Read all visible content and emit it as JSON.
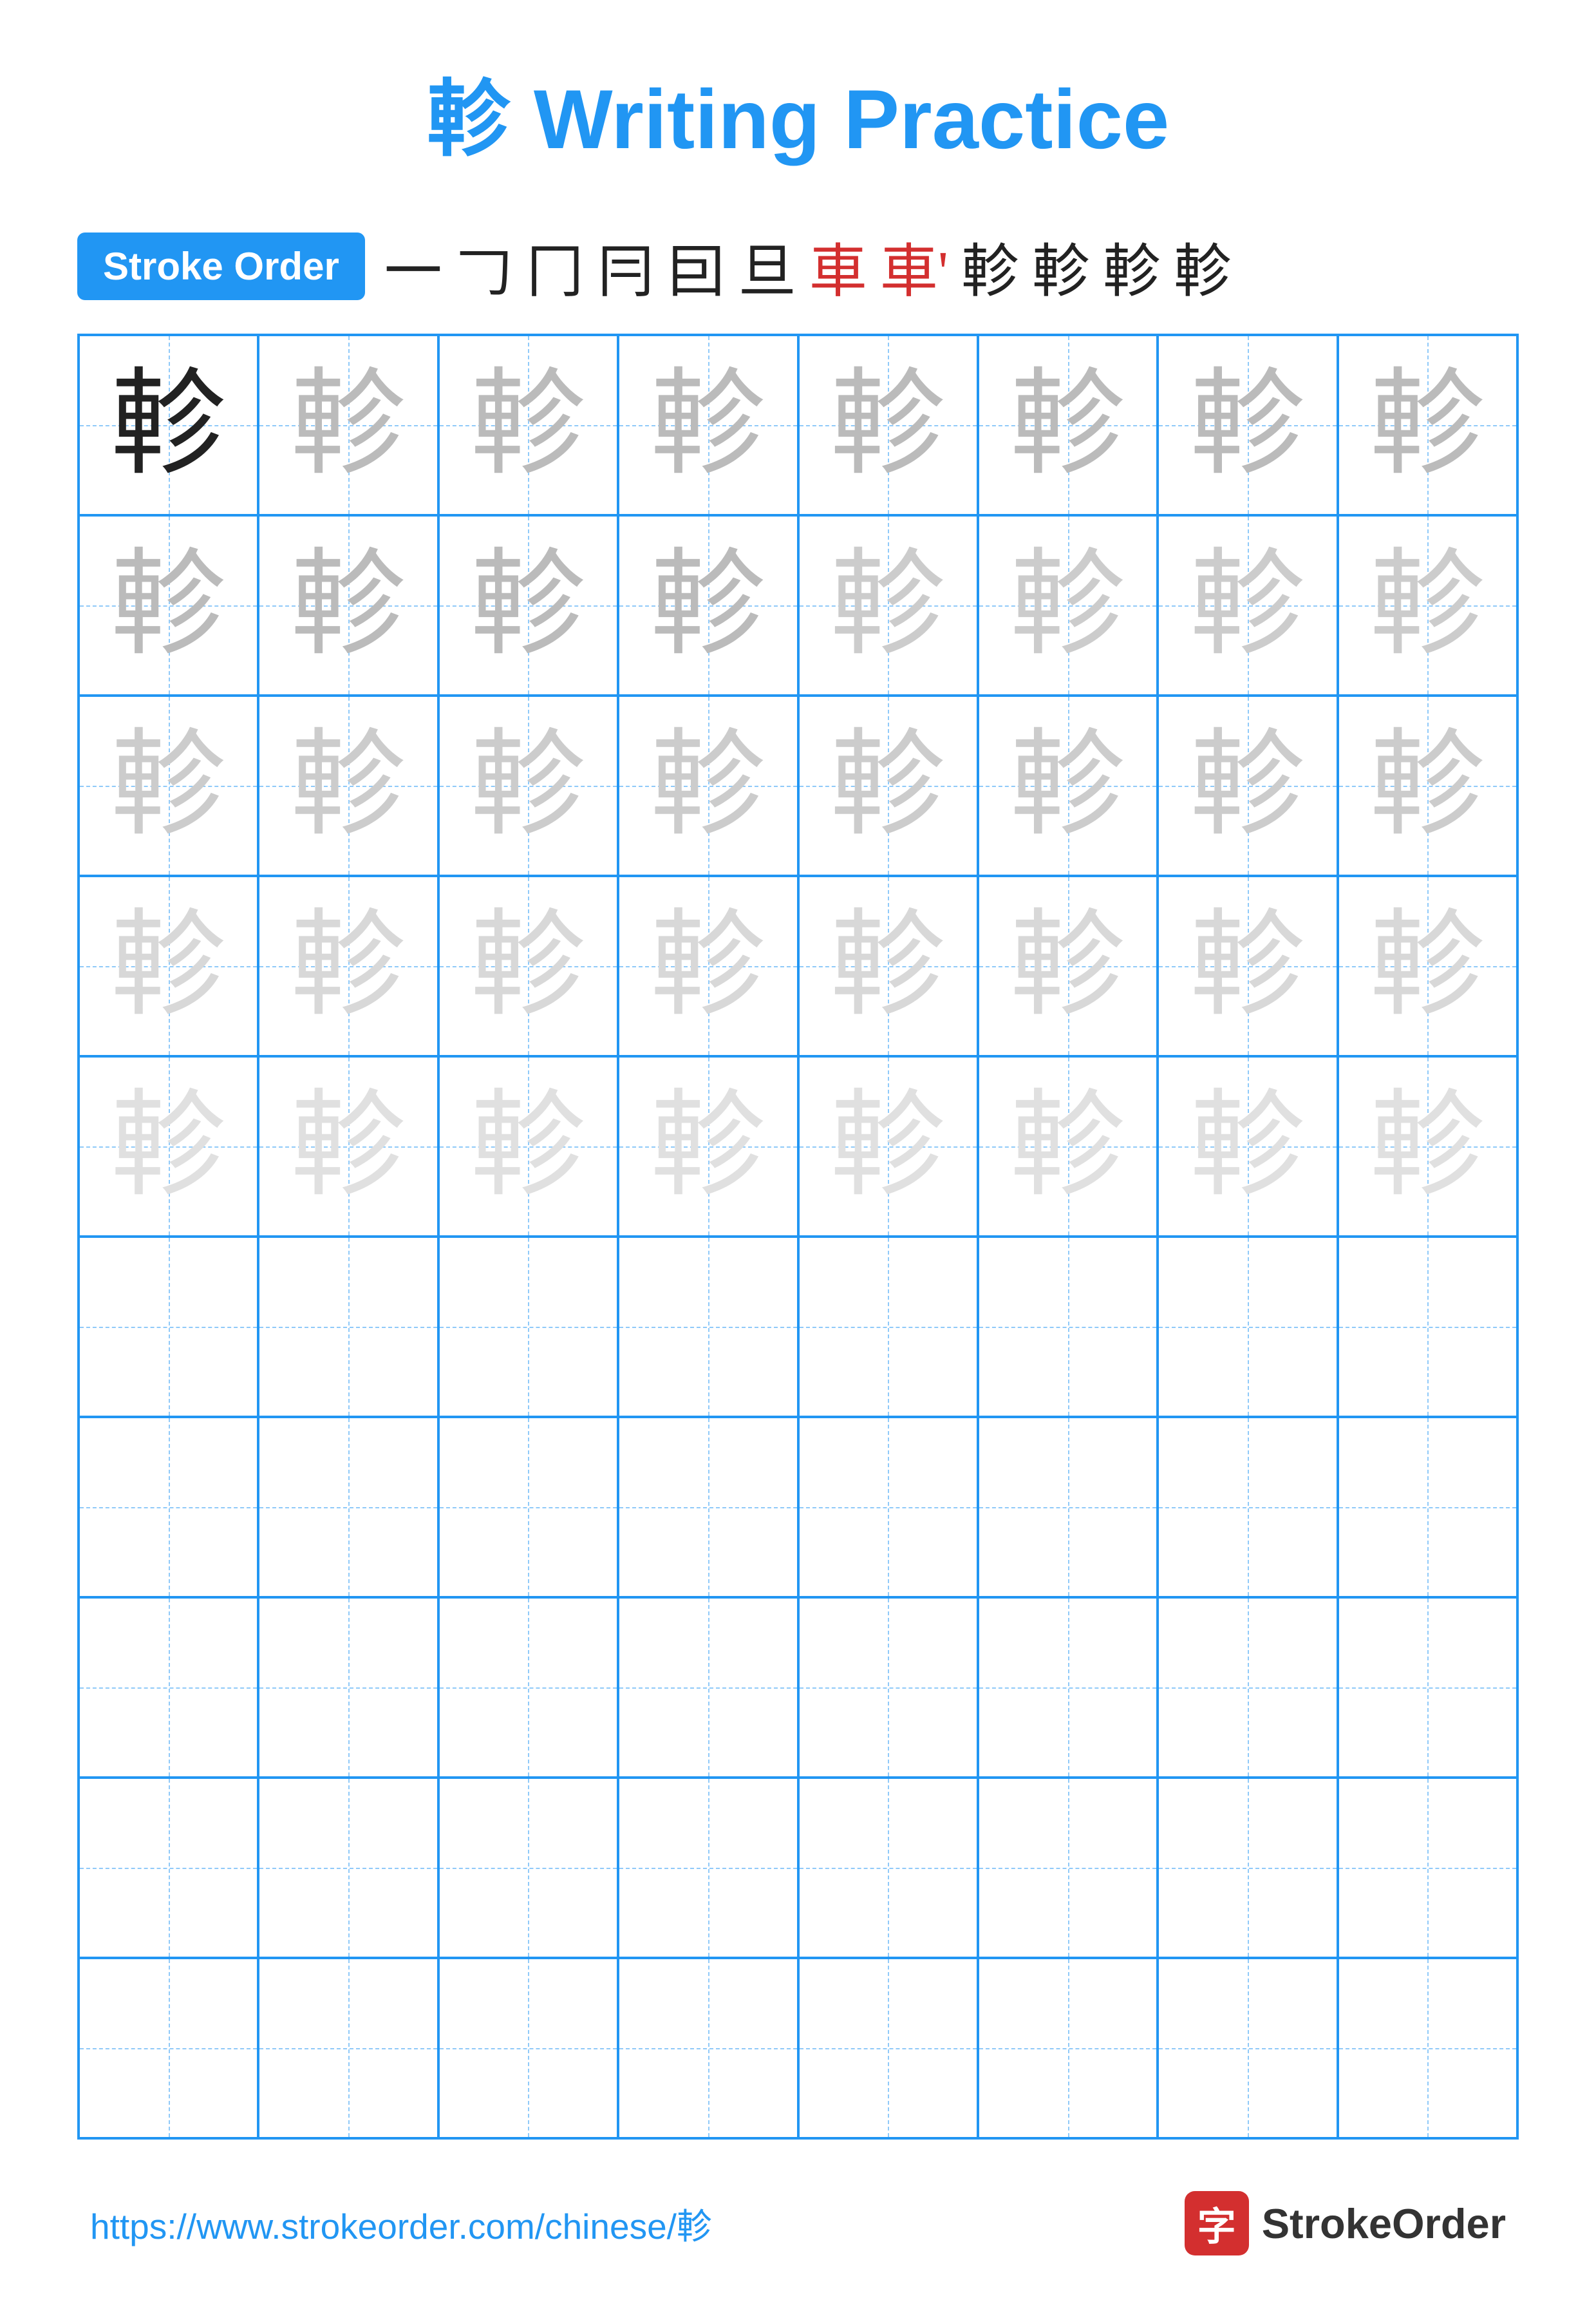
{
  "title": "軫 Writing Practice",
  "strokeOrder": {
    "badge": "Stroke Order",
    "chars": [
      "一",
      "𠃌",
      "冂",
      "冃",
      "囙",
      "旦",
      "車",
      "車'",
      "軫",
      "軫",
      "軫",
      "軫"
    ],
    "redIndex": [
      6,
      7
    ]
  },
  "character": "軫",
  "rows": [
    {
      "opacity": "solid",
      "count": 8
    },
    {
      "opacity": "light-1",
      "count": 8
    },
    {
      "opacity": "light-2",
      "count": 8
    },
    {
      "opacity": "light-3",
      "count": 8
    },
    {
      "opacity": "very-light",
      "count": 8
    },
    {
      "opacity": "empty",
      "count": 8
    },
    {
      "opacity": "empty",
      "count": 8
    },
    {
      "opacity": "empty",
      "count": 8
    },
    {
      "opacity": "empty",
      "count": 8
    },
    {
      "opacity": "empty",
      "count": 8
    }
  ],
  "footer": {
    "url": "https://www.strokeorder.com/chinese/軫",
    "logoChar": "字",
    "logoText": "StrokeOrder"
  }
}
